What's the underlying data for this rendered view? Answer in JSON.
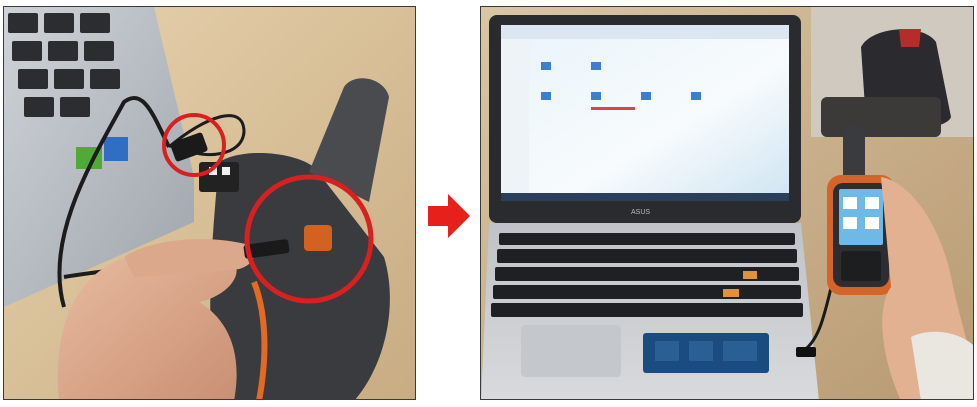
{
  "left_photo": {
    "description_icon": "gps-cable-connection-photo",
    "highlight_color": "#d92020"
  },
  "arrow": {
    "icon": "right-arrow-icon",
    "color": "#e8201c"
  },
  "right_photo": {
    "description_icon": "laptop-with-gps-device-photo",
    "laptop_brand": "ASUS"
  }
}
